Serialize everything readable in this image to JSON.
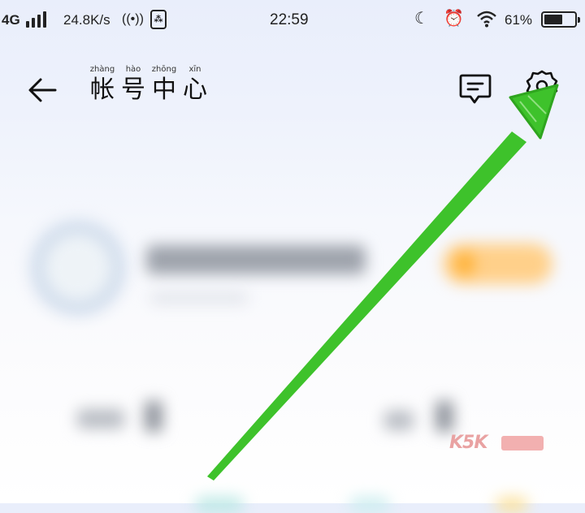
{
  "status_bar": {
    "network": "4G",
    "speed": "24.8K/s",
    "time": "22:59",
    "battery_percent": "61%",
    "battery_level": 0.61,
    "icons": [
      "signal-bars-icon",
      "hotspot-icon",
      "hd-badge-icon",
      "moon-icon",
      "alarm-icon",
      "wifi-icon",
      "battery-charging-icon"
    ]
  },
  "header": {
    "back_icon": "back-arrow-icon",
    "title_chars": [
      {
        "pinyin": "zhàng",
        "hanzi": "帐"
      },
      {
        "pinyin": "hào",
        "hanzi": "号"
      },
      {
        "pinyin": "zhōng",
        "hanzi": "中"
      },
      {
        "pinyin": "xīn",
        "hanzi": "心"
      }
    ],
    "message_icon": "message-icon",
    "settings_icon": "gear-icon"
  },
  "annotation": {
    "arrow_color": "#3ec22b",
    "points_to": "settings-button"
  },
  "watermark": {
    "text": "K5K"
  },
  "colors": {
    "background_top": "#e9eefb",
    "background_bottom": "#ffffff",
    "vip_accent": "#ffae2d"
  }
}
